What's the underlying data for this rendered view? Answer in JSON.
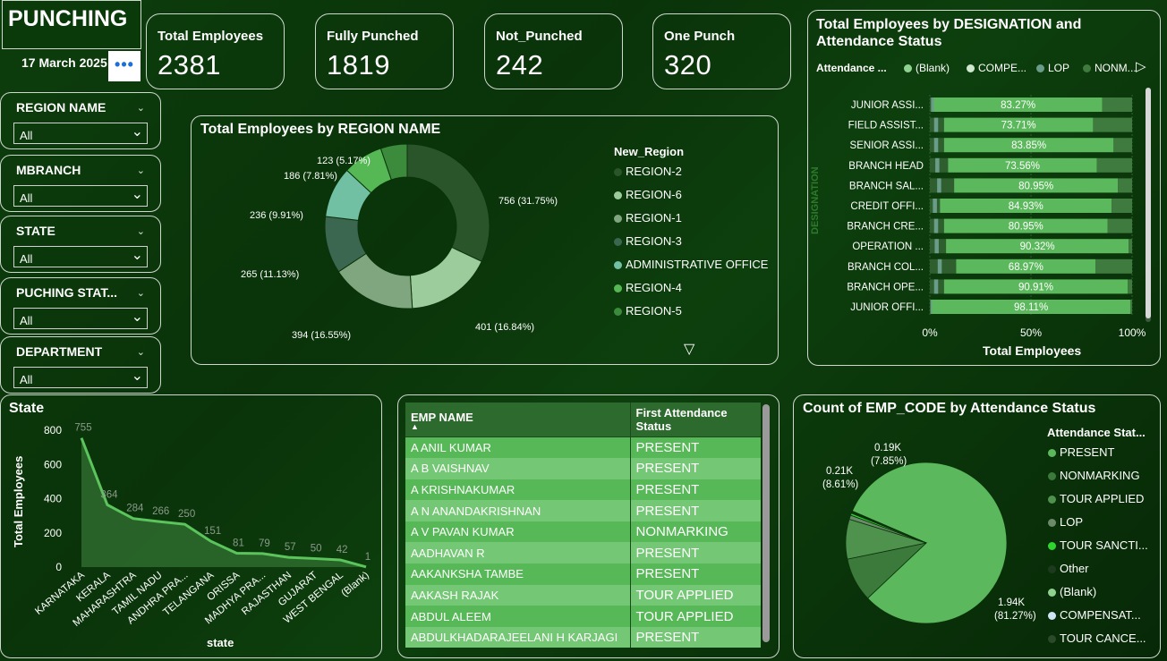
{
  "header": {
    "title": "PUNCHING",
    "date": "17 March 2025",
    "more_label": "•••"
  },
  "kpis": [
    {
      "label": "Total Employees",
      "value": "2381"
    },
    {
      "label": "Fully Punched",
      "value": "1819"
    },
    {
      "label": "Not_Punched",
      "value": "242"
    },
    {
      "label": "One Punch",
      "value": "320"
    }
  ],
  "slicers": [
    {
      "label": "REGION NAME",
      "value": "All"
    },
    {
      "label": "MBRANCH",
      "value": "All"
    },
    {
      "label": "STATE",
      "value": "All"
    },
    {
      "label": "PUCHING STAT...",
      "value": "All"
    },
    {
      "label": "DEPARTMENT",
      "value": "All"
    }
  ],
  "region_chart": {
    "title": "Total Employees by REGION NAME",
    "legend_title": "New_Region",
    "colors": [
      "#2a552a",
      "#9ccc9c",
      "#7fa67f",
      "#3b6650",
      "#72c0a4",
      "#55b855",
      "#3c8a3c"
    ],
    "slice_labels": [
      "756 (31.75%)",
      "401 (16.84%)",
      "394 (16.55%)",
      "265 (11.13%)",
      "236 (9.91%)",
      "186 (7.81%)",
      "123 (5.17%)"
    ],
    "legend": [
      "REGION-2",
      "REGION-6",
      "REGION-1",
      "REGION-3",
      "ADMINISTRATIVE OFFICE",
      "REGION-4",
      "REGION-5"
    ]
  },
  "designation_chart": {
    "title_line1": "Total Employees by DESIGNATION and",
    "title_line2": "Attendance Status",
    "legend_title": "Attendance ...",
    "legend": [
      {
        "label": "(Blank)",
        "color": "#8fd18f"
      },
      {
        "label": "COMPE...",
        "color": "#cfe8cf"
      },
      {
        "label": "LOP",
        "color": "#6a9c8a"
      },
      {
        "label": "NONM...",
        "color": "#3f7a3f"
      }
    ],
    "axis_title": "DESIGNATION",
    "x_axis_title": "Total Employees",
    "x_ticks": [
      "0%",
      "50%",
      "100%"
    ],
    "categories": [
      "JUNIOR ASSI...",
      "FIELD ASSIST...",
      "SENIOR ASSI...",
      "BRANCH HEAD",
      "BRANCH SAL...",
      "CREDIT OFFI...",
      "BRANCH CRE...",
      "OPERATION ...",
      "BRANCH COL...",
      "BRANCH OPE...",
      "JUNIOR OFFI..."
    ],
    "present_pct": [
      "83.27%",
      "73.71%",
      "83.85%",
      "73.56%",
      "80.95%",
      "84.93%",
      "80.95%",
      "90.32%",
      "68.97%",
      "90.91%",
      "98.11%"
    ]
  },
  "state_chart": {
    "title": "State",
    "y_axis_title": "Total Employees",
    "x_axis_title": "state",
    "y_ticks": [
      "800",
      "600",
      "400",
      "200",
      "0"
    ],
    "categories": [
      "KARNATAKA",
      "KERALA",
      "MAHARASHTRA",
      "TAMIL NADU",
      "ANDHRA PRA...",
      "TELANGANA",
      "ORISSA",
      "MADHYA PRA...",
      "RAJASTHAN",
      "GUJARAT",
      "WEST BENGAL",
      "(Blank)"
    ],
    "value_labels": [
      "755",
      "364",
      "284",
      "266",
      "250",
      "151",
      "81",
      "79",
      "57",
      "50",
      "42",
      "1"
    ]
  },
  "emp_table": {
    "columns": [
      "EMP NAME",
      "First Attendance Status"
    ],
    "rows": [
      [
        "A ANIL KUMAR",
        "PRESENT"
      ],
      [
        "A B VAISHNAV",
        "PRESENT"
      ],
      [
        "A KRISHNAKUMAR",
        "PRESENT"
      ],
      [
        "A N ANANDAKRISHNAN",
        "PRESENT"
      ],
      [
        "A V PAVAN KUMAR",
        "NONMARKING"
      ],
      [
        "AADHAVAN R",
        "PRESENT"
      ],
      [
        "AAKANKSHA TAMBE",
        "PRESENT"
      ],
      [
        "AAKASH RAJAK",
        "TOUR APPLIED"
      ],
      [
        "ABDUL ALEEM",
        "TOUR APPLIED"
      ],
      [
        "ABDULKHADARAJEELANI H KARJAGI",
        "PRESENT"
      ]
    ]
  },
  "status_chart": {
    "title": "Count of EMP_CODE by Attendance Status",
    "legend_title": "Attendance Stat...",
    "slice_labels": [
      {
        "top": "1.94K",
        "bottom": "(81.27%)"
      },
      {
        "top": "0.21K",
        "bottom": "(8.61%)"
      },
      {
        "top": "0.19K",
        "bottom": "(7.85%)"
      }
    ],
    "legend": [
      {
        "label": "PRESENT",
        "color": "#5cb85c"
      },
      {
        "label": "NONMARKING",
        "color": "#3c7a3c"
      },
      {
        "label": "TOUR APPLIED",
        "color": "#4e924e"
      },
      {
        "label": "LOP",
        "color": "#6a8a6a"
      },
      {
        "label": "TOUR SANCTI...",
        "color": "#2fd52f"
      },
      {
        "label": "Other",
        "color": "#1e3a1e"
      },
      {
        "label": "(Blank)",
        "color": "#8fd18f"
      },
      {
        "label": "COMPENSAT...",
        "color": "#cfe5f5"
      },
      {
        "label": "TOUR CANCE...",
        "color": "#2a4a2a"
      }
    ]
  },
  "chart_data": [
    {
      "type": "pie",
      "title": "Total Employees by REGION NAME",
      "categories": [
        "REGION-2",
        "REGION-6",
        "REGION-1",
        "REGION-3",
        "ADMINISTRATIVE OFFICE",
        "REGION-4",
        "REGION-5"
      ],
      "values": [
        756,
        401,
        394,
        265,
        236,
        186,
        123
      ]
    },
    {
      "type": "bar",
      "title": "Total Employees by DESIGNATION and Attendance Status",
      "categories": [
        "JUNIOR ASSI...",
        "FIELD ASSIST...",
        "SENIOR ASSI...",
        "BRANCH HEAD",
        "BRANCH SAL...",
        "CREDIT OFFI...",
        "BRANCH CRE...",
        "OPERATION ...",
        "BRANCH COL...",
        "BRANCH OPE...",
        "JUNIOR OFFI..."
      ],
      "series": [
        {
          "values": [
            83.27,
            73.71,
            83.85,
            73.56,
            80.95,
            84.93,
            80.95,
            90.32,
            68.97,
            90.91,
            98.11
          ]
        }
      ],
      "xlabel": "Total Employees",
      "ylabel": "DESIGNATION",
      "xlim": [
        0,
        100
      ]
    },
    {
      "type": "area",
      "title": "State",
      "categories": [
        "KARNATAKA",
        "KERALA",
        "MAHARASHTRA",
        "TAMIL NADU",
        "ANDHRA PRA...",
        "TELANGANA",
        "ORISSA",
        "MADHYA PRA...",
        "RAJASTHAN",
        "GUJARAT",
        "WEST BENGAL",
        "(Blank)"
      ],
      "values": [
        755,
        364,
        284,
        266,
        250,
        151,
        81,
        79,
        57,
        50,
        42,
        1
      ],
      "xlabel": "state",
      "ylabel": "Total Employees",
      "ylim": [
        0,
        800
      ]
    },
    {
      "type": "pie",
      "title": "Count of EMP_CODE by Attendance Status",
      "categories": [
        "PRESENT",
        "NONMARKING",
        "TOUR APPLIED",
        "LOP",
        "TOUR SANCTI...",
        "Other",
        "(Blank)",
        "COMPENSAT...",
        "TOUR CANCE..."
      ],
      "values": [
        1940,
        210,
        190,
        20,
        10,
        5,
        3,
        2,
        1
      ]
    }
  ]
}
